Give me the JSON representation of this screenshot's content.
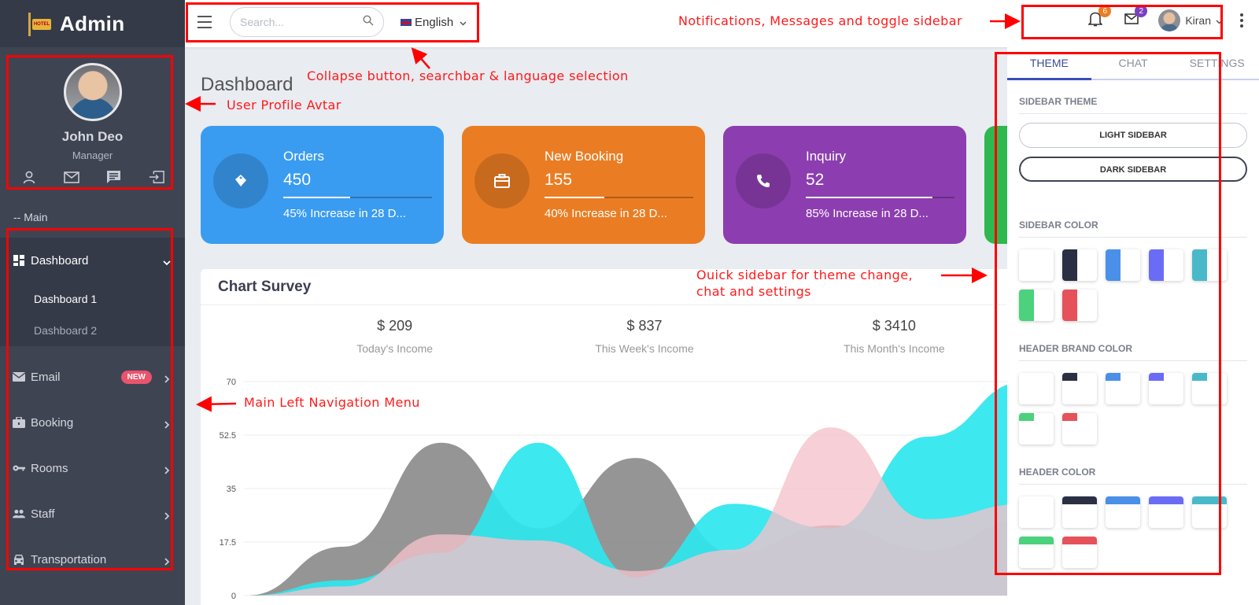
{
  "brand": {
    "title": "Admin",
    "logo_text": "HOTEL"
  },
  "profile": {
    "name": "John Deo",
    "role": "Manager"
  },
  "sidebar": {
    "section_label": "-- Main",
    "items": [
      {
        "label": "Dashboard",
        "icon": "dashboard-icon",
        "open": true,
        "children": [
          {
            "label": "Dashboard 1",
            "active": true
          },
          {
            "label": "Dashboard 2",
            "active": false
          }
        ]
      },
      {
        "label": "Email",
        "icon": "email-icon",
        "badge": "NEW"
      },
      {
        "label": "Booking",
        "icon": "briefcase-icon"
      },
      {
        "label": "Rooms",
        "icon": "key-icon"
      },
      {
        "label": "Staff",
        "icon": "people-icon"
      },
      {
        "label": "Transportation",
        "icon": "car-icon"
      }
    ]
  },
  "header": {
    "search_placeholder": "Search...",
    "language": "English",
    "notifications_count": "6",
    "messages_count": "2",
    "user_name": "Kiran"
  },
  "main": {
    "title": "Dashboard",
    "cards": [
      {
        "title": "Orders",
        "value": "450",
        "progress": 0.45,
        "sub": "45% Increase in 28 D...",
        "color": "#3a9cf0",
        "icon": "tag-icon"
      },
      {
        "title": "New Booking",
        "value": "155",
        "progress": 0.4,
        "sub": "40% Increase in 28 D...",
        "color": "#ea7d23",
        "icon": "briefcase-icon"
      },
      {
        "title": "Inquiry",
        "value": "52",
        "progress": 0.85,
        "sub": "85% Increase in 28 D...",
        "color": "#8c3eb0",
        "icon": "phone-icon"
      }
    ],
    "panel_title": "Chart Survey",
    "stats": [
      {
        "value": "$ 209",
        "label": "Today's Income"
      },
      {
        "value": "$ 837",
        "label": "This Week's Income"
      },
      {
        "value": "$ 3410",
        "label": "This Month's Income"
      }
    ]
  },
  "chart_data": {
    "type": "area",
    "yticks": [
      "70",
      "52.5",
      "35",
      "17.5",
      "0"
    ],
    "ylim": [
      0,
      70
    ],
    "x": [
      0,
      1,
      2,
      3,
      4,
      5,
      6,
      7,
      8
    ],
    "series": [
      {
        "color": "#8c8c8c",
        "values": [
          0,
          16,
          50,
          22,
          45,
          14,
          23,
          15,
          25
        ]
      },
      {
        "color": "#2ee6ee",
        "values": [
          0,
          5,
          14,
          50,
          6,
          30,
          22,
          52,
          70
        ]
      },
      {
        "color": "#f5c1cb",
        "values": [
          0,
          3,
          20,
          18,
          8,
          15,
          55,
          25,
          30
        ]
      }
    ]
  },
  "quick": {
    "tabs": [
      "THEME",
      "CHAT",
      "SETTINGS"
    ],
    "sidebar_theme_heading": "SIDEBAR THEME",
    "light_sidebar": "LIGHT SIDEBAR",
    "dark_sidebar": "DARK SIDEBAR",
    "sidebar_color_heading": "SIDEBAR COLOR",
    "header_brand_heading": "HEADER BRAND COLOR",
    "header_color_heading": "HEADER COLOR",
    "colors": [
      "#ffffff",
      "#2a2f43",
      "#4a8fe8",
      "#6b6cf5",
      "#49b9c9",
      "#4cd17c",
      "#e5525a"
    ]
  },
  "annotations": {
    "header_left": "Collapse button, searchbar & language selection",
    "header_right": "Notifications, Messages and toggle sidebar",
    "profile": "User Profile Avtar",
    "nav": "Main Left Navigation Menu",
    "quick_line1": "Ouick sidebar for theme change,",
    "quick_line2": "chat and settings"
  }
}
